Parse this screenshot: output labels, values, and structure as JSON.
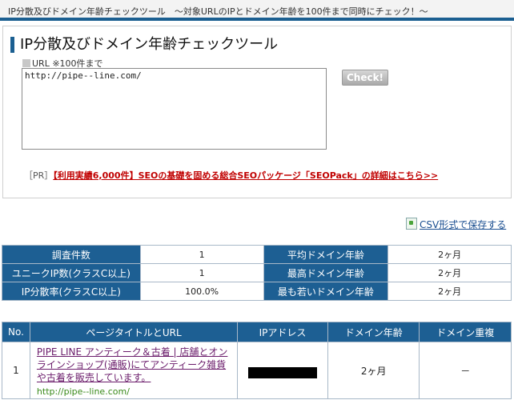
{
  "header": {
    "banner": "IP分散及びドメイン年齢チェックツール　～対象URLのIPとドメイン年齢を100件まで同時にチェック！～"
  },
  "tool": {
    "title": "IP分散及びドメイン年齢チェックツール",
    "url_label": "URL ※100件まで",
    "url_value": "http://pipe--line.com/",
    "check_label": "Check!"
  },
  "pr": {
    "tag": "［PR］",
    "link": "【利用実績6,000件】SEOの基礎を固める総合SEOパッケージ「SEOPack」の詳細はこちら>>"
  },
  "csv": {
    "label": "CSV形式で保存する",
    "icon": "csv-file-icon"
  },
  "stats": {
    "survey_count_label": "調査件数",
    "survey_count": "1",
    "avg_age_label": "平均ドメイン年齢",
    "avg_age": "2ヶ月",
    "unique_ip_label": "ユニークIP数(クラスC以上)",
    "unique_ip": "1",
    "max_age_label": "最高ドメイン年齢",
    "max_age": "2ヶ月",
    "ip_rate_label": "IP分散率(クラスC以上)",
    "ip_rate": "100.0%",
    "min_age_label": "最も若いドメイン年齢",
    "min_age": "2ヶ月"
  },
  "results": {
    "headers": [
      "No.",
      "ページタイトルとURL",
      "IPアドレス",
      "ドメイン年齢",
      "ドメイン重複"
    ],
    "rows": [
      {
        "no": "1",
        "title": "PIPE LINE アンティーク＆古着 | 店舗とオンラインショップ(通販)にてアンティーク雑貨や古着を販売しています。",
        "url": "http://pipe--line.com/",
        "age": "2ヶ月",
        "duplicate": "－"
      }
    ]
  },
  "colors": {
    "header_blue": "#1d5f93",
    "pr_red": "#c00000"
  }
}
